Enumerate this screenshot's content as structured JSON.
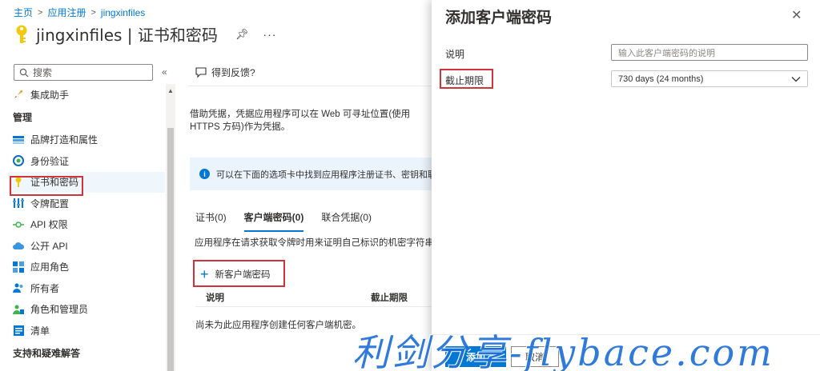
{
  "breadcrumb": [
    "主页",
    "应用注册",
    "jingxinfiles"
  ],
  "page_title": "jingxinfiles | 证书和密码",
  "sidebar": {
    "search_placeholder": "搜索",
    "items": [
      {
        "label": "集成助手",
        "icon": "rocket-icon"
      },
      {
        "section": "管理"
      },
      {
        "label": "品牌打造和属性",
        "icon": "branding-icon"
      },
      {
        "label": "身份验证",
        "icon": "authentication-icon"
      },
      {
        "label": "证书和密码",
        "icon": "key-icon",
        "active": true
      },
      {
        "label": "令牌配置",
        "icon": "token-config-icon"
      },
      {
        "label": "API 权限",
        "icon": "api-permissions-icon"
      },
      {
        "label": "公开 API",
        "icon": "cloud-icon"
      },
      {
        "label": "应用角色",
        "icon": "app-roles-icon"
      },
      {
        "label": "所有者",
        "icon": "owners-icon"
      },
      {
        "label": "角色和管理员",
        "icon": "roles-admins-icon"
      },
      {
        "label": "清单",
        "icon": "manifest-icon"
      },
      {
        "section": "支持和疑难解答"
      }
    ]
  },
  "main": {
    "feedback_label": "得到反馈?",
    "description": "借助凭据，凭据应用程序可以在 Web 可寻址位置(使用 HTTPS 方码)作为凭据。",
    "info_text": "可以在下面的选项卡中找到应用程序注册证书、密钥和联合凭",
    "tabs": [
      "证书(0)",
      "客户端密码(0)",
      "联合凭据(0)"
    ],
    "tab_description": "应用程序在请求获取令牌时用来证明自己标识的机密字符串。",
    "new_secret_label": "新客户端密码",
    "table_headers": [
      "说明",
      "截止期限"
    ],
    "empty_message": "尚未为此应用程序创建任何客户端机密。"
  },
  "panel": {
    "title": "添加客户端密码",
    "description_label": "说明",
    "description_placeholder": "输入此客户端密码的说明",
    "expires_label": "截止期限",
    "expires_value": "730 days (24 months)",
    "add_button": "添加",
    "cancel_button": "取消"
  },
  "watermark": "利剑分享-flybace.com",
  "colors": {
    "accent": "#0078d4",
    "highlight": "#d13438"
  }
}
